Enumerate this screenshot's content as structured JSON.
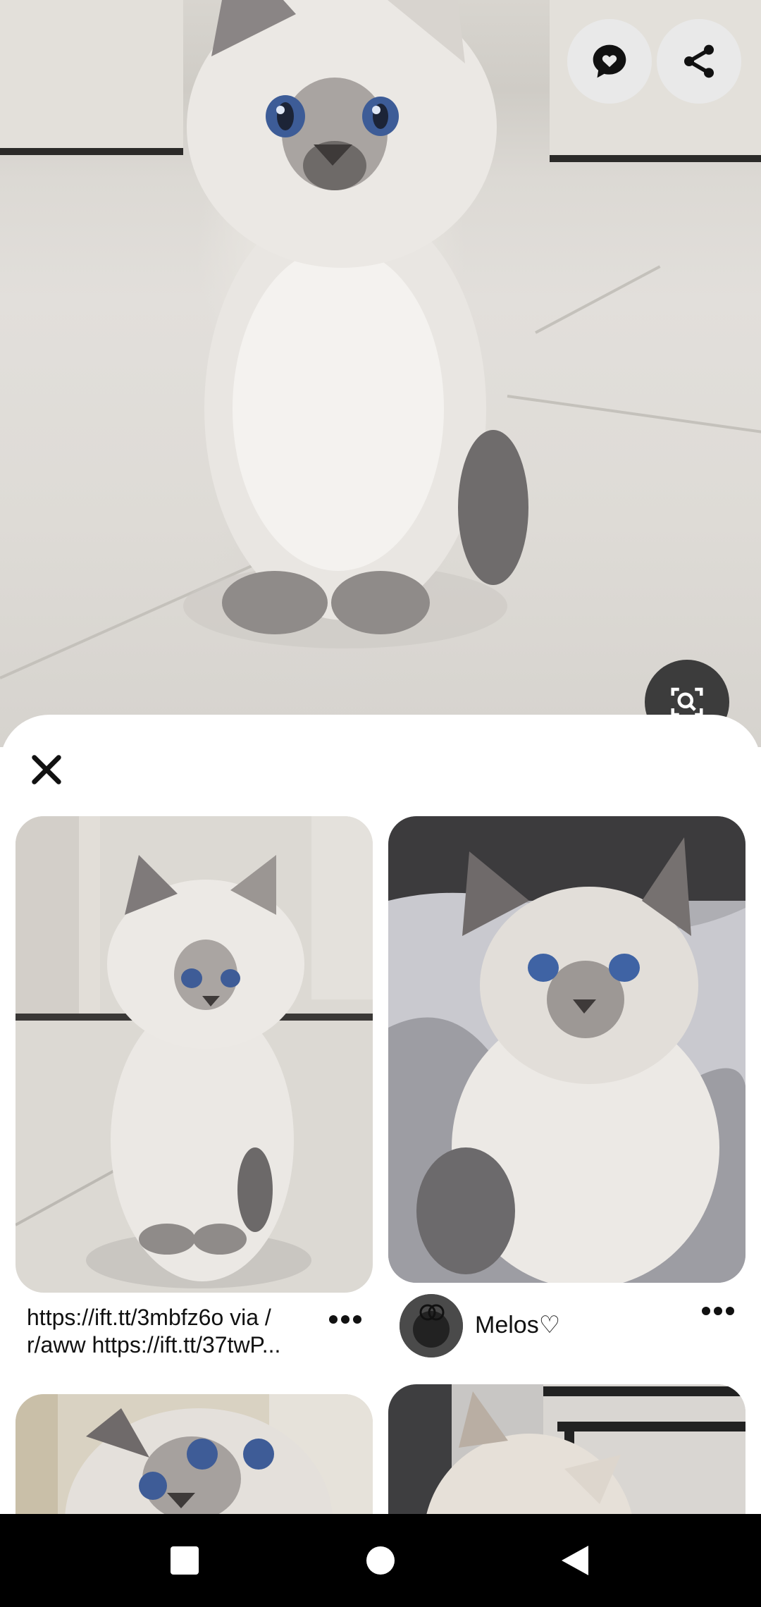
{
  "hero": {
    "alt_subject": "kitten",
    "comment_button_icon": "heart-speech-bubble-icon",
    "share_button_icon": "share-icon",
    "visual_search_icon": "lens-search-icon"
  },
  "sheet": {
    "close_icon": "close-icon",
    "pins": [
      {
        "caption": "https://ift.tt/3mbfz6o via /\nr/aww https://ift.tt/37twP...",
        "more_icon": "more-horizontal-icon"
      },
      {
        "user_name": "Melos♡",
        "more_icon": "more-horizontal-icon"
      }
    ]
  },
  "navbar": {
    "recents_icon": "square-icon",
    "home_icon": "circle-icon",
    "back_icon": "triangle-back-icon"
  },
  "colors": {
    "fab_bg": "#e9e9e9",
    "fab_dark_bg": "#3c3c3c",
    "sheet_bg": "#ffffff",
    "navbar_bg": "#000000",
    "nav_icon": "#ffffff"
  }
}
